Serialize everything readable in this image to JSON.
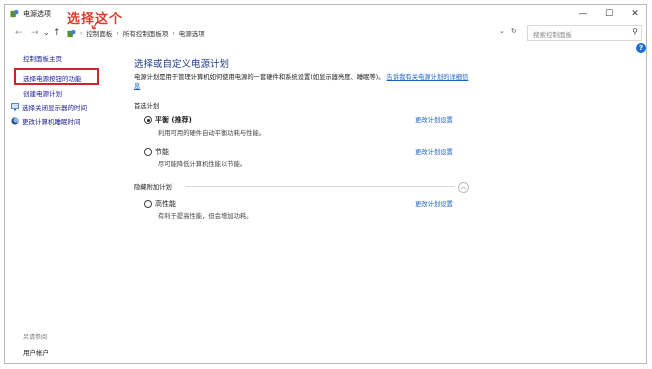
{
  "window": {
    "title": "电源选项",
    "controls": {
      "minimize": "—",
      "maximize": "☐",
      "close": "✕"
    }
  },
  "address_bar": {
    "nav": {
      "back": "←",
      "forward": "→",
      "up": "↑"
    },
    "breadcrumbs": [
      "控制面板",
      "所有控制面板项",
      "电源选项"
    ],
    "search_placeholder": "搜索控制面板"
  },
  "sidebar": {
    "home": "控制面板主页",
    "items": [
      {
        "label": "选择电源按钮的功能"
      },
      {
        "label": "创建电源计划"
      },
      {
        "label": "选择关闭显示器的时间"
      },
      {
        "label": "更改计算机睡眠时间"
      }
    ],
    "see_also": "另请参阅",
    "user_accounts": "用户帐户"
  },
  "annotation": {
    "text": "选择这个",
    "color": "#e23a2e"
  },
  "main": {
    "heading": "选择或自定义电源计划",
    "description": "电源计划是用于管理计算机如何使用电源的一套硬件和系统设置(如显示器亮度、睡眠等)。",
    "description_link": "告诉我有关电源计划的详细信息",
    "preferred_label": "首选计划",
    "hidden_label": "隐藏附加计划",
    "plans": [
      {
        "name": "平衡 (推荐)",
        "desc": "利用可用的硬件自动平衡功耗与性能。",
        "selected": true,
        "change": "更改计划设置"
      },
      {
        "name": "节能",
        "desc": "尽可能降低计算机性能以节能。",
        "selected": false,
        "change": "更改计划设置"
      },
      {
        "name": "高性能",
        "desc": "有利于提高性能，但会增加功耗。",
        "selected": false,
        "change": "更改计划设置"
      }
    ]
  },
  "colors": {
    "link": "#1a5fc8",
    "heading": "#1e3a8a",
    "highlight_border": "#d0242d",
    "help": "#1f6fcf"
  }
}
